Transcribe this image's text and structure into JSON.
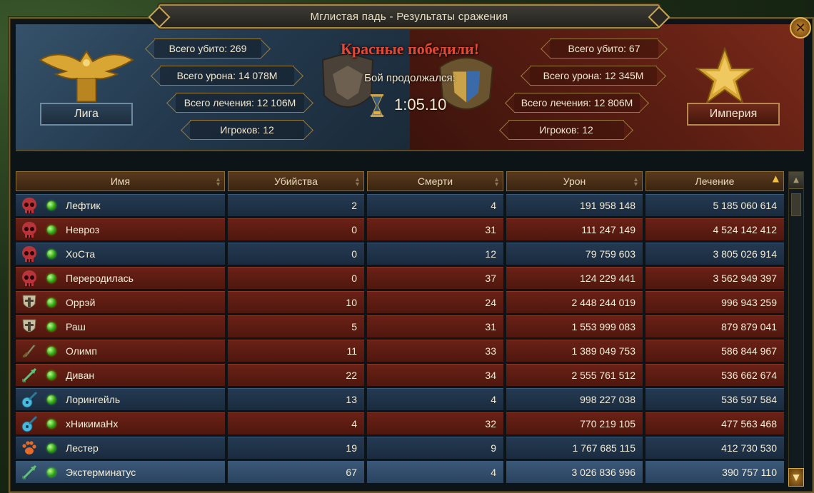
{
  "window": {
    "title": "Мглистая падь - Результаты сражения",
    "close_icon": "close-icon"
  },
  "colors": {
    "blue_team": "#243a52",
    "red_team": "#6a2116",
    "victory_text": "#e64732",
    "online": "#2fa314"
  },
  "league": {
    "name": "Лига",
    "emblem_icon": "golden-eagle-emblem",
    "total_kills": "Всего убито: 269",
    "total_damage": "Всего урона: 14 078M",
    "total_heal": "Всего лечения: 12 106M",
    "players": "Игроков: 12"
  },
  "empire": {
    "name": "Империя",
    "emblem_icon": "golden-star-emblem",
    "total_kills": "Всего убито: 67",
    "total_damage": "Всего урона: 12 345M",
    "total_heal": "Всего лечения: 12 806M",
    "players": "Игроков: 12"
  },
  "battle": {
    "result": "Красные победили!",
    "duration_label": "Бой продолжался:",
    "duration": "1:05.10"
  },
  "table": {
    "columns": [
      "Имя",
      "Убийства",
      "Смерти",
      "Урон",
      "Лечение"
    ],
    "sorted_column": "Лечение",
    "rows": [
      {
        "team": "blue",
        "class_icon": "skull-icon",
        "name": "Лефтик",
        "kills": "2",
        "deaths": "4",
        "damage": "191 958 148",
        "heal": "5 185 060 614"
      },
      {
        "team": "red",
        "class_icon": "skull-icon",
        "name": "Невроз",
        "kills": "0",
        "deaths": "31",
        "damage": "111 247 149",
        "heal": "4 524 142 412"
      },
      {
        "team": "blue",
        "class_icon": "skull-icon",
        "name": "ХоСта",
        "kills": "0",
        "deaths": "12",
        "damage": "79 759 603",
        "heal": "3 805 026 914"
      },
      {
        "team": "red",
        "class_icon": "skull-icon",
        "name": "Переродилась",
        "kills": "0",
        "deaths": "37",
        "damage": "124 229 441",
        "heal": "3 562 949 397"
      },
      {
        "team": "red",
        "class_icon": "shield-icon",
        "name": "Оррэй",
        "kills": "10",
        "deaths": "24",
        "damage": "2 448 244 019",
        "heal": "996 943 259"
      },
      {
        "team": "red",
        "class_icon": "shield-icon",
        "name": "Раш",
        "kills": "5",
        "deaths": "31",
        "damage": "1 553 999 083",
        "heal": "879 879 041"
      },
      {
        "team": "red",
        "class_icon": "sword-icon",
        "name": "Олимп",
        "kills": "11",
        "deaths": "33",
        "damage": "1 389 049 753",
        "heal": "586 844 967"
      },
      {
        "team": "red",
        "class_icon": "bow-icon",
        "name": "Диван",
        "kills": "22",
        "deaths": "34",
        "damage": "2 555 761 512",
        "heal": "536 662 674"
      },
      {
        "team": "blue",
        "class_icon": "lute-icon",
        "name": "Лорингейль",
        "kills": "13",
        "deaths": "4",
        "damage": "998 227 038",
        "heal": "536 597 584"
      },
      {
        "team": "red",
        "class_icon": "lute-icon",
        "name": "хНикимаНх",
        "kills": "4",
        "deaths": "32",
        "damage": "770 219 105",
        "heal": "477 563 468"
      },
      {
        "team": "blue",
        "class_icon": "paw-icon",
        "name": "Лестер",
        "kills": "19",
        "deaths": "9",
        "damage": "1 767 685 115",
        "heal": "412 730 530"
      },
      {
        "team": "blue",
        "class_icon": "bow-icon",
        "name": "Экстерминатус",
        "kills": "67",
        "deaths": "4",
        "damage": "3 026 836 996",
        "heal": "390 757 110",
        "selected": true
      }
    ]
  }
}
